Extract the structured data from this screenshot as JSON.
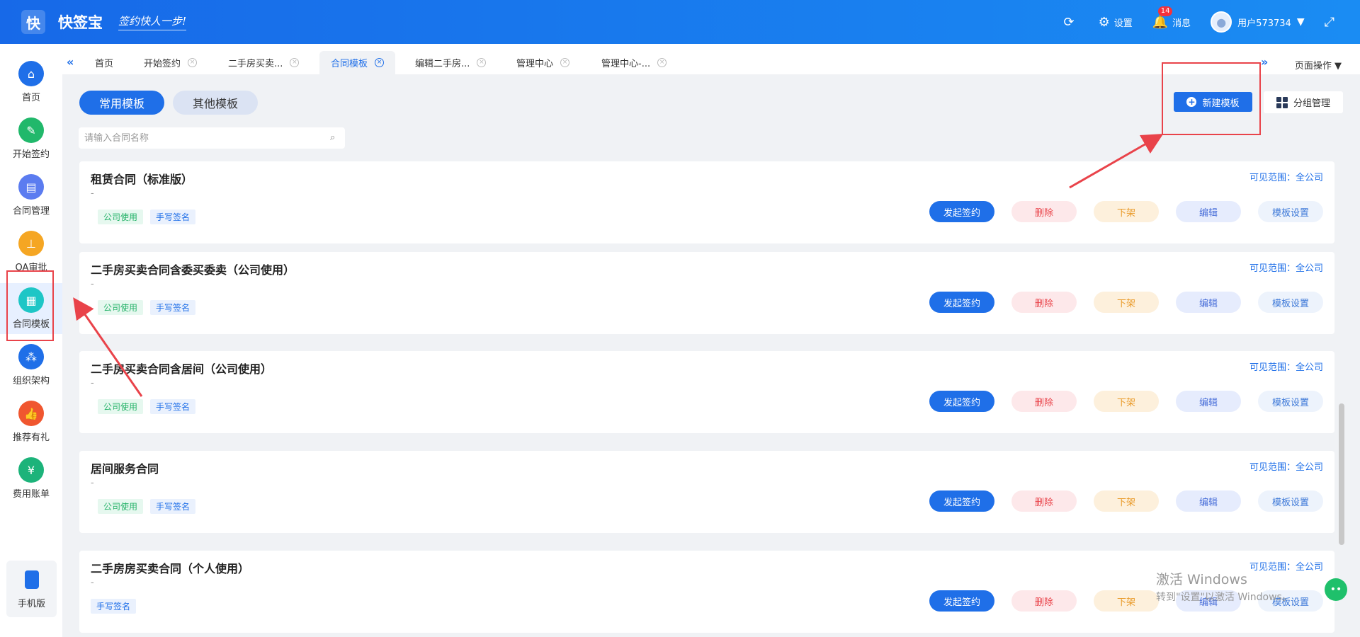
{
  "header": {
    "logo_char": "快",
    "app_name": "快签宝",
    "slogan": "签约快人一步!",
    "refresh_icon": "⟳",
    "settings_label": "设置",
    "messages_label": "消息",
    "messages_badge": "14",
    "username": "用户573734",
    "dropdown_icon": "▼",
    "fullscreen_icon": "⤢"
  },
  "sidebar": {
    "items": [
      {
        "label": "首页",
        "icon": "home-icon",
        "glyph": "⌂",
        "color": "#1f6fe8"
      },
      {
        "label": "开始签约",
        "icon": "sign-icon",
        "glyph": "✎",
        "color": "#21b86b"
      },
      {
        "label": "合同管理",
        "icon": "contract-icon",
        "glyph": "▤",
        "color": "#5b7cf0"
      },
      {
        "label": "OA审批",
        "icon": "stamp-icon",
        "glyph": "⊥",
        "color": "#f5a623"
      },
      {
        "label": "合同模板",
        "icon": "template-icon",
        "glyph": "▦",
        "color": "#1ec6c6"
      },
      {
        "label": "组织架构",
        "icon": "org-icon",
        "glyph": "⁂",
        "color": "#1f6fe8"
      },
      {
        "label": "推荐有礼",
        "icon": "thumb-icon",
        "glyph": "👍",
        "color": "#f0562f"
      },
      {
        "label": "费用账单",
        "icon": "bill-icon",
        "glyph": "¥",
        "color": "#1cb37a"
      }
    ],
    "mobile_label": "手机版"
  },
  "tabs": {
    "collapse_left": "«",
    "expand_right": "»",
    "items": [
      {
        "label": "首页",
        "closable": false
      },
      {
        "label": "开始签约",
        "closable": true
      },
      {
        "label": "二手房买卖...",
        "closable": true
      },
      {
        "label": "合同模板",
        "closable": true
      },
      {
        "label": "编辑二手房...",
        "closable": true
      },
      {
        "label": "管理中心",
        "closable": true
      },
      {
        "label": "管理中心-...",
        "closable": true
      }
    ],
    "close_glyph": "×",
    "page_ops": "页面操作 ▼"
  },
  "toolbar": {
    "common_templates": "常用模板",
    "other_templates": "其他模板",
    "search_placeholder": "请输入合同名称",
    "search_icon": "⌕",
    "new_template": "新建模板",
    "new_plus": "+",
    "group_manage": "分组管理"
  },
  "cards": [
    {
      "title": "租赁合同（标准版）",
      "dash": "-",
      "scope": "可见范围：全公司",
      "tags": [
        "公司使用",
        "手写签名"
      ]
    },
    {
      "title": "二手房买卖合同含委买委卖（公司使用）",
      "dash": "-",
      "scope": "可见范围：全公司",
      "tags": [
        "公司使用",
        "手写签名"
      ]
    },
    {
      "title": "二手房买卖合同含居间（公司使用）",
      "dash": "-",
      "scope": "可见范围：全公司",
      "tags": [
        "公司使用",
        "手写签名"
      ]
    },
    {
      "title": "居间服务合同",
      "dash": "-",
      "scope": "可见范围：全公司",
      "tags": [
        "公司使用",
        "手写签名"
      ]
    },
    {
      "title": "二手房房买卖合同（个人使用）",
      "dash": "-",
      "scope": "可见范围：全公司",
      "tags": [
        "手写签名"
      ]
    }
  ],
  "actions": {
    "start": "发起签约",
    "delete": "删除",
    "offline": "下架",
    "edit": "编辑",
    "settings": "模板设置"
  },
  "watermark": {
    "line1": "激活 Windows",
    "line2": "转到\"设置\"以激活 Windows。"
  },
  "chat_glyph": "••",
  "colors": {
    "primary": "#1f6fe8",
    "annotation_red": "#e9434a"
  }
}
